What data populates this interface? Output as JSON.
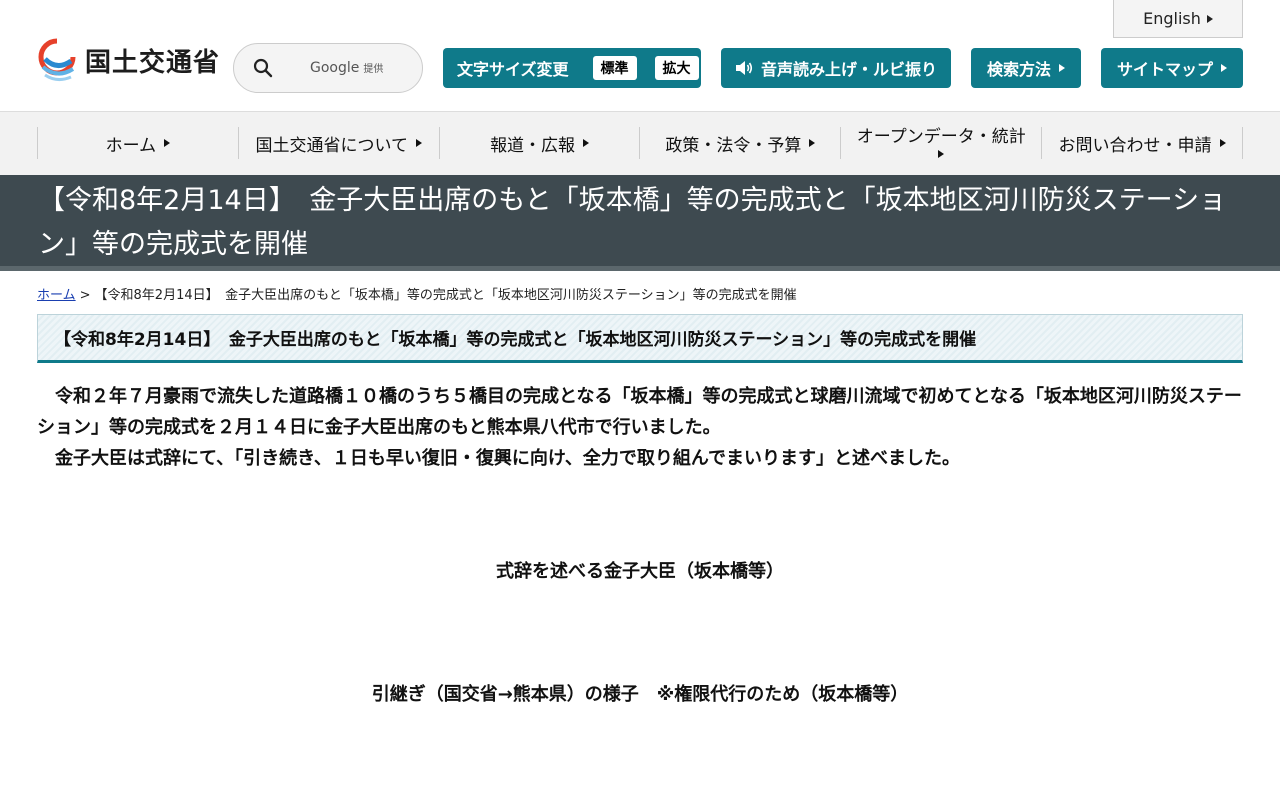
{
  "header": {
    "english_label": "English",
    "logo_text": "国土交通省",
    "search": {
      "brand": "Google",
      "brand_suffix": "提供"
    },
    "text_size": {
      "label": "文字サイズ変更",
      "standard": "標準",
      "large": "拡大"
    },
    "speech_label": "音声読み上げ・ルビ振り",
    "search_method_label": "検索方法",
    "sitemap_label": "サイトマップ"
  },
  "nav": {
    "items": [
      {
        "label": "ホーム"
      },
      {
        "label": "国土交通省について"
      },
      {
        "label": "報道・広報"
      },
      {
        "label": "政策・法令・予算"
      },
      {
        "label": "オープンデータ・統計"
      },
      {
        "label": "お問い合わせ・申請"
      }
    ]
  },
  "page": {
    "title": "【令和8年2月14日】　金子大臣出席のもと「坂本橋」等の完成式と「坂本地区河川防災ステーション」等の完成式を開催",
    "breadcrumb": {
      "home": "ホーム",
      "separator": ">",
      "current": "【令和8年2月14日】　金子大臣出席のもと「坂本橋」等の完成式と「坂本地区河川防災ステーション」等の完成式を開催"
    },
    "heading": "【令和8年2月14日】　金子大臣出席のもと「坂本橋」等の完成式と「坂本地区河川防災ステーション」等の完成式を開催",
    "paragraph1": "　令和２年７月豪雨で流失した道路橋１０橋のうち５橋目の完成となる「坂本橋」等の完成式と球磨川流域で初めてとなる「坂本地区河川防災ステーション」等の完成式を２月１４日に金子大臣出席のもと熊本県八代市で行いました。",
    "paragraph2": "　金子大臣は式辞にて、「引き続き、１日も早い復旧・復興に向け、全力で取り組んでまいります」と述べました。",
    "caption1": "式辞を述べる金子大臣（坂本橋等）",
    "caption2": "引継ぎ（国交省→熊本県）の様子　※権限代行のため（坂本橋等）"
  },
  "colors": {
    "accent": "#0f7a8a",
    "title_band": "#3e4a50",
    "nav_bg": "#f2f2f2"
  }
}
